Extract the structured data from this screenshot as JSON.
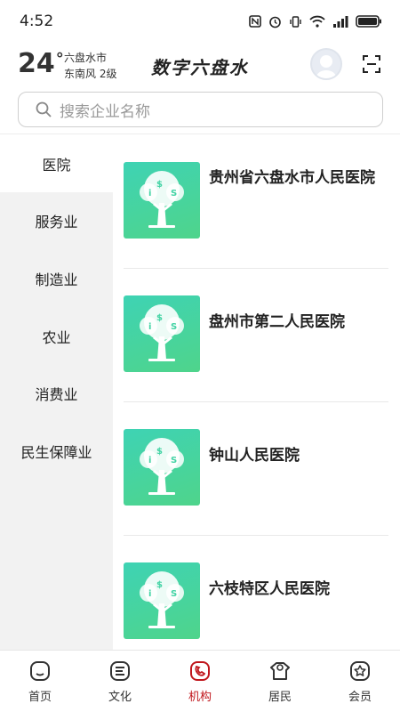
{
  "status_bar": {
    "time": "4:52"
  },
  "header": {
    "temperature": "24",
    "degree_symbol": "°",
    "city": "六盘水市",
    "wind": "东南风  2级",
    "app_title": "数字六盘水"
  },
  "search": {
    "placeholder": "搜索企业名称"
  },
  "categories": [
    {
      "label": "医院",
      "active": true
    },
    {
      "label": "服务业",
      "active": false
    },
    {
      "label": "制造业",
      "active": false
    },
    {
      "label": "农业",
      "active": false
    },
    {
      "label": "消费业",
      "active": false
    },
    {
      "label": "民生保障业",
      "active": false
    }
  ],
  "organizations": [
    {
      "name": "贵州省六盘水市人民医院"
    },
    {
      "name": "盘州市第二人民医院"
    },
    {
      "name": "钟山人民医院"
    },
    {
      "name": "六枝特区人民医院"
    }
  ],
  "tabs": [
    {
      "label": "首页",
      "icon": "home-icon",
      "active": false
    },
    {
      "label": "文化",
      "icon": "culture-icon",
      "active": false
    },
    {
      "label": "机构",
      "icon": "institution-icon",
      "active": true
    },
    {
      "label": "居民",
      "icon": "resident-icon",
      "active": false
    },
    {
      "label": "会员",
      "icon": "member-icon",
      "active": false
    }
  ],
  "colors": {
    "accent": "#c0161c",
    "thumb_start": "#3ed3b4",
    "thumb_end": "#4fd48b"
  }
}
